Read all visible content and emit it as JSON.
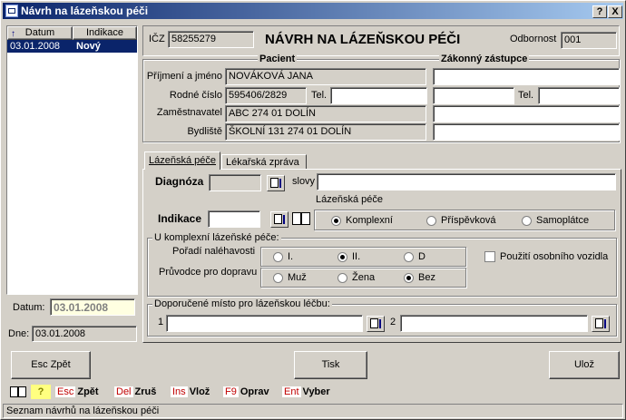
{
  "window": {
    "title": "Návrh na lázeňskou péči",
    "help_btn": "?",
    "close_btn": "X"
  },
  "list": {
    "columns": [
      "Datum",
      "Indikace"
    ],
    "rows": [
      {
        "date": "03.01.2008",
        "indication": "Nový"
      }
    ]
  },
  "left": {
    "datum_label": "Datum:",
    "datum_value": "03.01.2008",
    "dne_label": "Dne:",
    "dne_value": "03.01.2008"
  },
  "header": {
    "icz_label": "IČZ",
    "icz_value": "58255279",
    "form_title": "NÁVRH NA LÁZEŇSKOU PÉČI",
    "odbornost_label": "Odbornost",
    "odbornost_value": "001"
  },
  "patient": {
    "group_label": "Pacient",
    "guardian_label": "Zákonný zástupce",
    "surname_label": "Příjmení a jméno",
    "surname_value": "NOVÁKOVÁ JANA",
    "birthno_label": "Rodné číslo",
    "birthno_value": "595406/2829",
    "tel_label": "Tel.",
    "tel_value": "",
    "employer_label": "Zaměstnavatel",
    "employer_value": "ABC   274 01 DOLÍN",
    "address_label": "Bydliště",
    "address_value": "ŠKOLNÍ 131  274 01 DOLÍN",
    "guardian_tel_label": "Tel."
  },
  "tabs": [
    {
      "label": "Lázeňská péče",
      "active": true
    },
    {
      "label": "Lékařská zpráva",
      "active": false
    }
  ],
  "care": {
    "diagnosis_label": "Diagnóza",
    "slovy_label": "slovy",
    "indication_label": "Indikace",
    "care_group_label": "Lázeňská péče",
    "care_options": [
      "Komplexní",
      "Příspěvková",
      "Samoplátce"
    ],
    "care_selected": 0,
    "complex_group_label": "U komplexní lázeňské péče:",
    "urgency_label": "Pořadí naléhavosti",
    "urgency_options": [
      "I.",
      "II.",
      "D"
    ],
    "urgency_selected": 1,
    "companion_label": "Průvodce pro dopravu",
    "companion_options": [
      "Muž",
      "Žena",
      "Bez"
    ],
    "companion_selected": 2,
    "own_car_label": "Použití osobního vozidla",
    "place_group_label": "Doporučené místo pro lázeňskou léčbu:",
    "place1_label": "1",
    "place2_label": "2"
  },
  "buttons": {
    "back": "Esc Zpět",
    "print": "Tisk",
    "save": "Ulož"
  },
  "hotkeys": [
    {
      "key": "Esc",
      "label": "Zpět"
    },
    {
      "key": "Del",
      "label": "Zruš"
    },
    {
      "key": "Ins",
      "label": "Vlož"
    },
    {
      "key": "F9",
      "label": "Oprav"
    },
    {
      "key": "Ent",
      "label": "Vyber"
    }
  ],
  "status": "Seznam návrhů na lázeňskou péči"
}
